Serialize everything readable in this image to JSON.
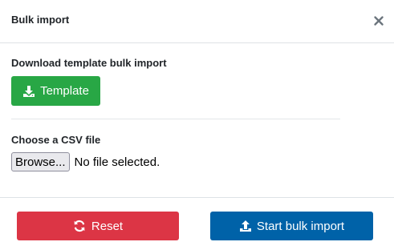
{
  "header": {
    "title": "Bulk import",
    "close_icon": "close-icon"
  },
  "template_section": {
    "label": "Download template bulk import",
    "button_label": "Template",
    "button_icon": "download-icon",
    "button_color": "#28a745"
  },
  "file_section": {
    "label": "Choose a CSV file",
    "browse_label": "Browse...",
    "file_status": "No file selected."
  },
  "footer": {
    "reset_label": "Reset",
    "reset_icon": "refresh-icon",
    "reset_color": "#dc3545",
    "start_label": "Start bulk import",
    "start_icon": "upload-icon",
    "start_color": "#0062a8"
  }
}
